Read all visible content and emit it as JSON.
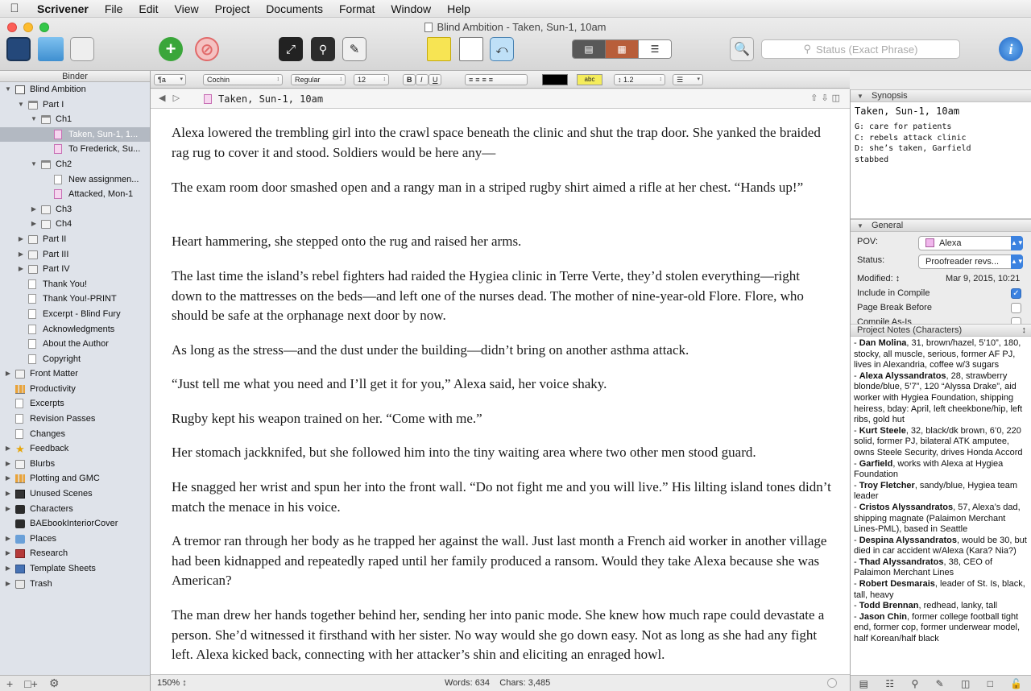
{
  "menubar": {
    "items": [
      "Scrivener",
      "File",
      "Edit",
      "View",
      "Project",
      "Documents",
      "Format",
      "Window",
      "Help"
    ]
  },
  "window": {
    "title": "Blind Ambition - Taken, Sun-1, 10am",
    "search_placeholder": "Status (Exact Phrase)"
  },
  "binder": {
    "header": "Binder",
    "items": [
      {
        "label": "Blind Ambition",
        "level": 0,
        "icon": "book",
        "toggle": "down"
      },
      {
        "label": "Part I",
        "level": 1,
        "icon": "folder-open",
        "toggle": "down"
      },
      {
        "label": "Ch1",
        "level": 2,
        "icon": "folder-open",
        "toggle": "down"
      },
      {
        "label": "Taken, Sun-1, 1...",
        "level": 3,
        "icon": "pink",
        "toggle": "",
        "selected": true
      },
      {
        "label": "To Frederick, Su...",
        "level": 3,
        "icon": "pink",
        "toggle": ""
      },
      {
        "label": "Ch2",
        "level": 2,
        "icon": "folder-open",
        "toggle": "down"
      },
      {
        "label": "New assignmen...",
        "level": 3,
        "icon": "page",
        "toggle": ""
      },
      {
        "label": "Attacked, Mon-1",
        "level": 3,
        "icon": "pink",
        "toggle": ""
      },
      {
        "label": "Ch3",
        "level": 2,
        "icon": "folder",
        "toggle": "right"
      },
      {
        "label": "Ch4",
        "level": 2,
        "icon": "folder",
        "toggle": "right"
      },
      {
        "label": "Part II",
        "level": 1,
        "icon": "folder",
        "toggle": "right"
      },
      {
        "label": "Part III",
        "level": 1,
        "icon": "folder",
        "toggle": "right"
      },
      {
        "label": "Part IV",
        "level": 1,
        "icon": "folder",
        "toggle": "right"
      },
      {
        "label": "Thank You!",
        "level": 1,
        "icon": "page",
        "toggle": ""
      },
      {
        "label": "Thank You!-PRINT",
        "level": 1,
        "icon": "page",
        "toggle": ""
      },
      {
        "label": "Excerpt - Blind Fury",
        "level": 1,
        "icon": "page",
        "toggle": ""
      },
      {
        "label": "Acknowledgments",
        "level": 1,
        "icon": "page",
        "toggle": ""
      },
      {
        "label": "About the Author",
        "level": 1,
        "icon": "page",
        "toggle": ""
      },
      {
        "label": "Copyright",
        "level": 1,
        "icon": "page",
        "toggle": ""
      },
      {
        "label": "Front Matter",
        "level": 0,
        "icon": "folder",
        "toggle": "right"
      },
      {
        "label": "Productivity",
        "level": 0,
        "icon": "chart",
        "toggle": ""
      },
      {
        "label": "Excerpts",
        "level": 0,
        "icon": "page",
        "toggle": ""
      },
      {
        "label": "Revision Passes",
        "level": 0,
        "icon": "page",
        "toggle": ""
      },
      {
        "label": "Changes",
        "level": 0,
        "icon": "page",
        "toggle": ""
      },
      {
        "label": "Feedback",
        "level": 0,
        "icon": "star",
        "toggle": "right"
      },
      {
        "label": "Blurbs",
        "level": 0,
        "icon": "folder",
        "toggle": "right"
      },
      {
        "label": "Plotting and GMC",
        "level": 0,
        "icon": "chart",
        "toggle": "right"
      },
      {
        "label": "Unused Scenes",
        "level": 0,
        "icon": "film",
        "toggle": "right"
      },
      {
        "label": "Characters",
        "level": 0,
        "icon": "person",
        "toggle": "right"
      },
      {
        "label": "BAEbookInteriorCover",
        "level": 0,
        "icon": "person",
        "toggle": ""
      },
      {
        "label": "Places",
        "level": 0,
        "icon": "globe",
        "toggle": "right"
      },
      {
        "label": "Research",
        "level": 0,
        "icon": "research",
        "toggle": "right"
      },
      {
        "label": "Template Sheets",
        "level": 0,
        "icon": "tmpl",
        "toggle": "right"
      },
      {
        "label": "Trash",
        "level": 0,
        "icon": "trash",
        "toggle": "right"
      }
    ]
  },
  "format_bar": {
    "paragraph_style": "¶a",
    "font": "Cochin",
    "typeface": "Regular",
    "size": "12",
    "bold": "B",
    "italic": "I",
    "underline": "U",
    "highlight_label": "abc",
    "line_spacing": "1.2"
  },
  "editor": {
    "doc_title": "Taken, Sun-1, 10am",
    "paragraphs": [
      "Alexa lowered the trembling girl into the crawl space beneath the clinic and shut the trap door. She yanked the braided rag rug to cover it and stood. Soldiers would be here any—",
      "The exam room door smashed open and a rangy man in a striped rugby shirt aimed a rifle at her chest. “Hands up!”",
      "Heart hammering, she stepped onto the rug and raised her arms.",
      "The last time the island’s rebel fighters had raided the Hygiea clinic in Terre Verte, they’d stolen everything—right down to the mattresses on the beds—and left one of the nurses dead. The mother of nine-year-old Flore. Flore, who should be safe at the orphanage next door by now.",
      "As long as the stress—and the dust under the building—didn’t bring on another asthma attack.",
      "“Just tell me what you need and I’ll get it for you,” Alexa said, her voice shaky.",
      "Rugby kept his weapon trained on her. “Come with me.”",
      "Her stomach jackknifed, but she followed him into the tiny waiting area where two other men stood guard.",
      "He snagged her wrist and spun her into the front wall. “Do not fight me and you will live.” His lilting island tones didn’t match the menace in his voice.",
      "A tremor ran through her body as he trapped her against the wall. Just last month a French aid worker in another village had been kidnapped and repeatedly raped until her family produced a ransom. Would they take Alexa because she was American?",
      "The man drew her hands together behind her, sending her into panic mode. She knew how much rape could devastate a person. She’d witnessed it firsthand with her sister. No way would she go down easy. Not as long as she had any fight left. Alexa kicked back, connecting with her attacker’s shin and eliciting an enraged howl."
    ],
    "zoom": "150%",
    "words": "Words: 634",
    "chars": "Chars: 3,485"
  },
  "inspector": {
    "synopsis_header": "Synopsis",
    "synopsis_title": "Taken, Sun-1, 10am",
    "synopsis_lines": [
      "G: care for patients",
      "C: rebels attack clinic",
      "D: she’s taken, Garfield",
      "stabbed"
    ],
    "general_header": "General",
    "pov_label": "POV:",
    "pov_value": "Alexa",
    "status_label": "Status:",
    "status_value": "Proofreader revs...",
    "modified_label": "Modified:",
    "modified_value": "Mar 9, 2015, 10:21",
    "include_label": "Include in Compile",
    "pagebreak_label": "Page Break Before",
    "compileas_label": "Compile As-Is",
    "include_checked": true,
    "pagebreak_checked": false,
    "compileas_checked": false,
    "notes_header": "Project Notes (Characters)",
    "notes": [
      {
        "name": "Dan Molina",
        "text": ", 31, brown/hazel, 5’10”, 180, stocky, all muscle, serious, former AF PJ, lives in Alexandria, coffee w/3 sugars"
      },
      {
        "name": "Alexa Alyssandratos",
        "text": ", 28, strawberry blonde/blue, 5’7”, 120 “Alyssa Drake”, aid worker with Hygiea Foundation, shipping heiress, bday: April, left cheekbone/hip, left ribs, gold hut"
      },
      {
        "name": "Kurt Steele",
        "text": ", 32, black/dk brown, 6’0, 220 solid, former PJ, bilateral ATK amputee, owns Steele Security, drives Honda Accord"
      },
      {
        "name": "Garfield",
        "text": ", works with Alexa at Hygiea Foundation"
      },
      {
        "name": "Troy Fletcher",
        "text": ", sandy/blue, Hygiea team leader"
      },
      {
        "name": "Cristos Alyssandratos",
        "text": ", 57, Alexa’s dad, shipping magnate (Palaimon Merchant Lines-PML), based in Seattle"
      },
      {
        "name": "Despina Alyssandratos",
        "text": ", would be 30, but died in car accident w/Alexa (Kara? Nia?)"
      },
      {
        "name": "Thad Alyssandratos",
        "text": ", 38, CEO of Palaimon Merchant Lines"
      },
      {
        "name": "Robert Desmarais",
        "text": ", leader of St. Is, black, tall, heavy"
      },
      {
        "name": "Todd Brennan",
        "text": ", redhead, lanky, tall"
      },
      {
        "name": "Jason Chin",
        "text": ", former college football tight end, former cop, former underwear model, half Korean/half black"
      }
    ]
  }
}
